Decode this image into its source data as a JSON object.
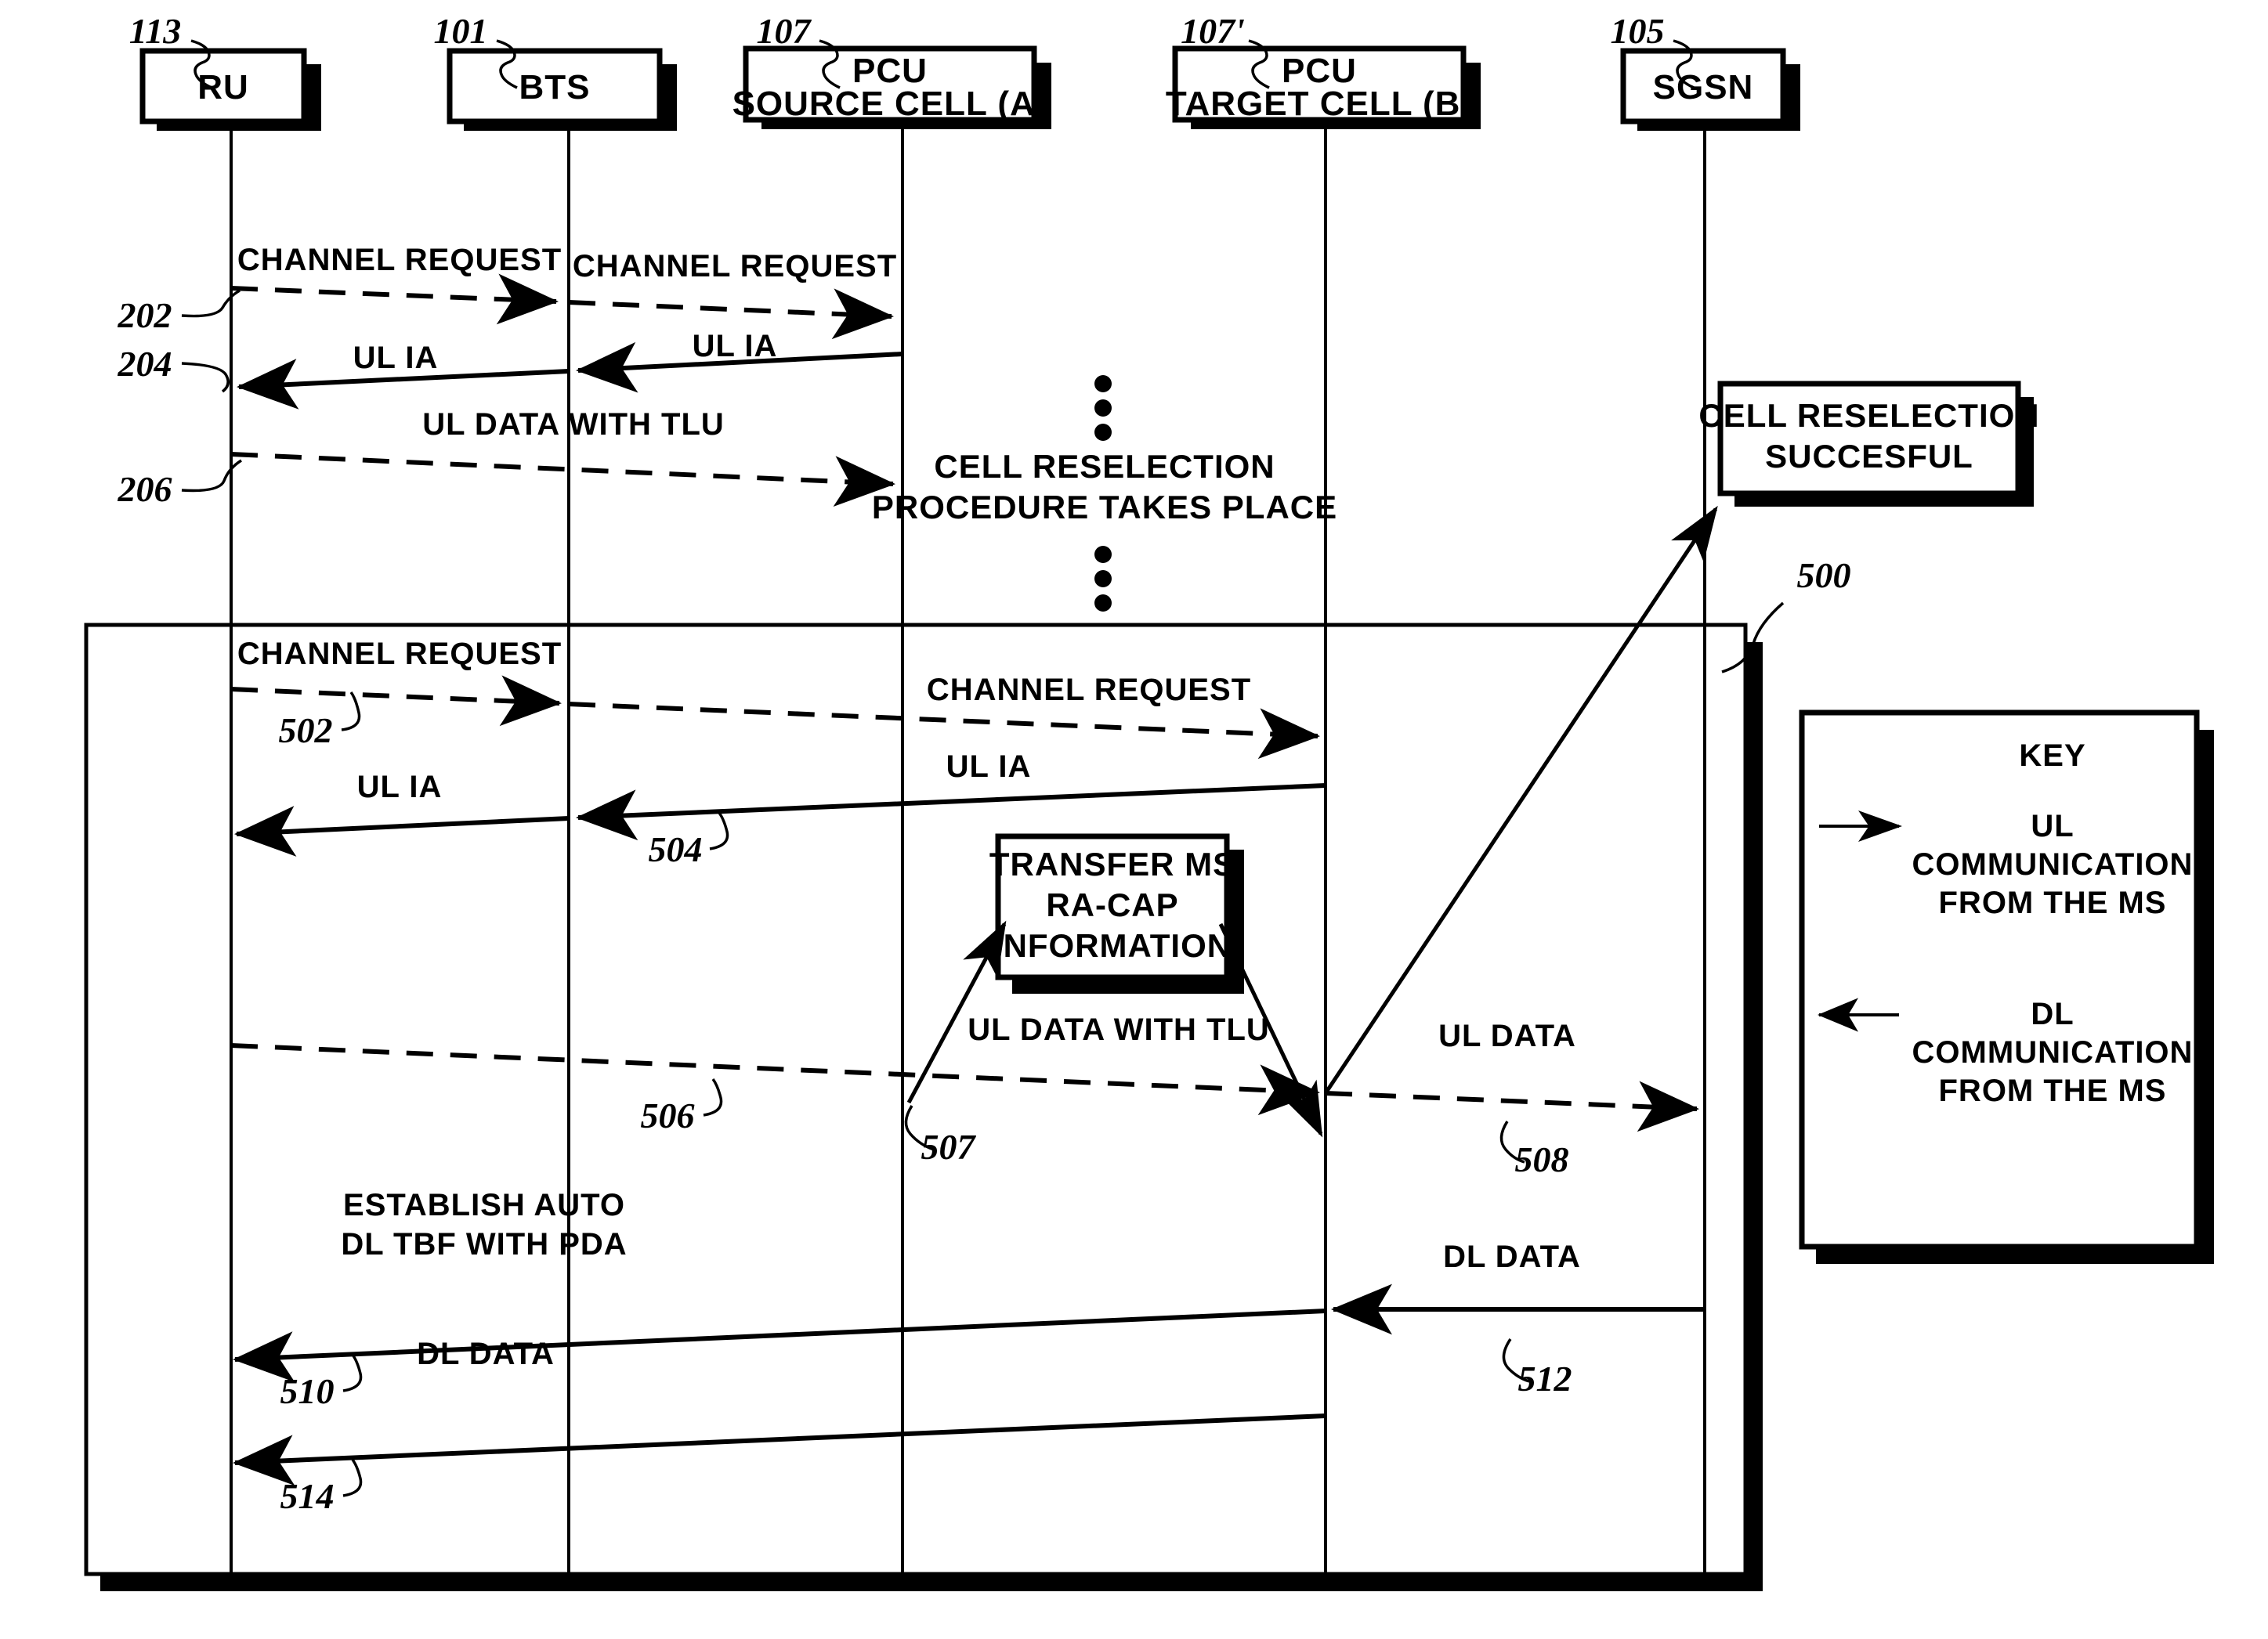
{
  "figure": {
    "ref_numbers": {
      "ru": "113",
      "bts": "101",
      "pcu_source": "107",
      "pcu_target": "107'",
      "sgsn": "105",
      "channel_request_1": "202",
      "ul_ia_1": "204",
      "ul_data_tlu_1": "206",
      "outer_block": "500",
      "channel_request_2": "502",
      "ul_ia_2": "504",
      "ul_data_tlu_2": "506",
      "transfer_ms_racap": "507",
      "ul_data": "508",
      "establish_auto_dl_tbf": "510",
      "dl_data_target": "512",
      "dl_data_final": "514"
    },
    "nodes": [
      {
        "id": "ru",
        "label_lines": [
          "RU"
        ]
      },
      {
        "id": "bts",
        "label_lines": [
          "BTS"
        ]
      },
      {
        "id": "pcu_source",
        "label_lines": [
          "PCU",
          "SOURCE CELL (A)"
        ]
      },
      {
        "id": "pcu_target",
        "label_lines": [
          "PCU",
          "TARGET CELL (B)"
        ]
      },
      {
        "id": "sgsn",
        "label_lines": [
          "SGSN"
        ]
      }
    ],
    "messages": [
      {
        "id": "m202a",
        "label": "CHANNEL REQUEST",
        "style": "dashed",
        "direction": "right"
      },
      {
        "id": "m202b",
        "label": "CHANNEL REQUEST",
        "style": "dashed",
        "direction": "right"
      },
      {
        "id": "m204a",
        "label": "UL IA",
        "style": "solid",
        "direction": "left"
      },
      {
        "id": "m204b",
        "label": "UL IA",
        "style": "solid",
        "direction": "left"
      },
      {
        "id": "m206",
        "label": "UL DATA WITH TLU",
        "style": "dashed",
        "direction": "right"
      },
      {
        "id": "m502a",
        "label": "CHANNEL REQUEST",
        "style": "dashed",
        "direction": "right"
      },
      {
        "id": "m502b",
        "label": "CHANNEL REQUEST",
        "style": "dashed",
        "direction": "right"
      },
      {
        "id": "m504a",
        "label": "UL IA",
        "style": "solid",
        "direction": "left"
      },
      {
        "id": "m504b",
        "label": "UL IA",
        "style": "solid",
        "direction": "left"
      },
      {
        "id": "m506",
        "label": "UL DATA WITH TLU",
        "style": "dashed",
        "direction": "right"
      },
      {
        "id": "m508",
        "label": "UL DATA",
        "style": "dashed",
        "direction": "right"
      },
      {
        "id": "m510",
        "label_lines": [
          "ESTABLISH AUTO",
          "DL TBF WITH PDA"
        ],
        "style": "solid",
        "direction": "left"
      },
      {
        "id": "m512",
        "label": "DL DATA",
        "style": "solid",
        "direction": "left"
      },
      {
        "id": "m514",
        "label": "DL DATA",
        "style": "solid",
        "direction": "left"
      }
    ],
    "notes": {
      "cell_reselection_procedure": [
        "CELL RESELECTION",
        "PROCEDURE TAKES PLACE"
      ],
      "cell_reselection_successful": [
        "CELL RESELECTION",
        "SUCCESFUL"
      ],
      "transfer_ms_racap": [
        "TRANSFER MS",
        "RA-CAP",
        "INFORMATION"
      ]
    },
    "key": {
      "title": "KEY",
      "entries": [
        {
          "arrow": "right",
          "label_lines": [
            "UL",
            "COMMUNICATION",
            "FROM THE MS"
          ]
        },
        {
          "arrow": "left",
          "label_lines": [
            "DL",
            "COMMUNICATION",
            "FROM THE MS"
          ]
        }
      ]
    },
    "colors": {
      "ink": "#000000",
      "paper": "#ffffff"
    }
  }
}
